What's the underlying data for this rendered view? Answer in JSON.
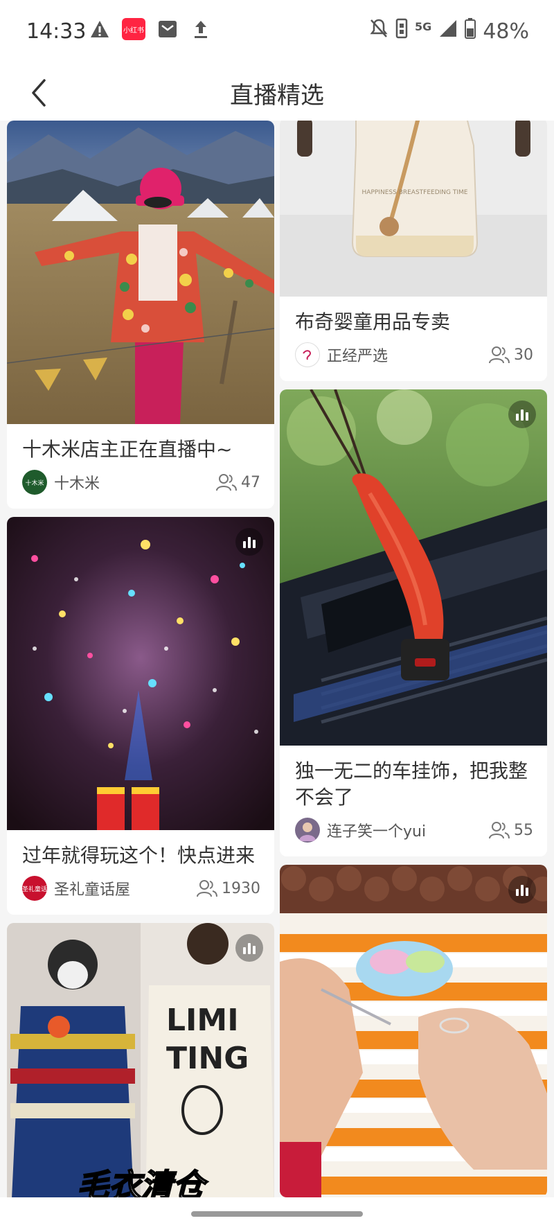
{
  "status_bar": {
    "time": "14:33",
    "app_badge": "小红书",
    "network": "5G",
    "battery": "48%"
  },
  "header": {
    "title": "直播精选"
  },
  "cards_left": [
    {
      "title": "十木米店主正在直播中~",
      "author": "十木米",
      "avatar_text": "十木米",
      "viewers": "47"
    },
    {
      "title": "过年就得玩这个！快点进来",
      "author": "圣礼童话屋",
      "avatar_text": "圣礼童话",
      "viewers": "1930"
    },
    {
      "overlay_text": "毛衣清仓",
      "shirt_text": "LIMI TING"
    }
  ],
  "cards_right": [
    {
      "title": "布奇婴童用品专卖",
      "author": "正经严选",
      "viewers": "30",
      "bottle_text": "HAPPINESS BREASTFEEDING TIME"
    },
    {
      "title": "独一无二的车挂饰，把我整不会了",
      "author": "连子笑一个yui",
      "viewers": "55"
    },
    {}
  ]
}
